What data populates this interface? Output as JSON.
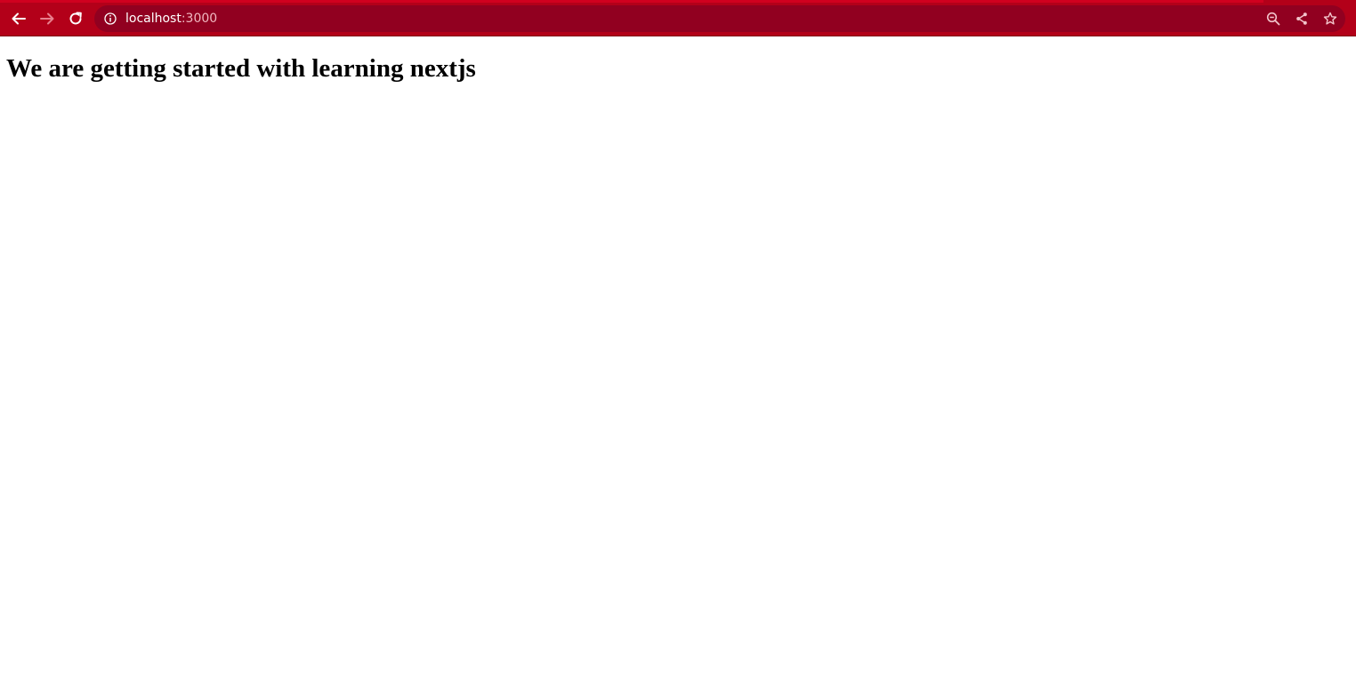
{
  "browser": {
    "address_bar": {
      "host": "localhost",
      "port": ":3000"
    },
    "colors": {
      "toolbar": "#b30019",
      "omnibox": "#910020",
      "icon_active": "#ffffff",
      "icon_disabled": "#e8808e"
    },
    "icons": {
      "back": "back-arrow-icon",
      "forward": "forward-arrow-icon",
      "reload": "reload-icon",
      "site_info": "info-icon",
      "zoom": "zoom-out-icon",
      "share": "share-icon",
      "bookmark": "star-icon"
    }
  },
  "page": {
    "heading": "We are getting started with learning nextjs"
  }
}
